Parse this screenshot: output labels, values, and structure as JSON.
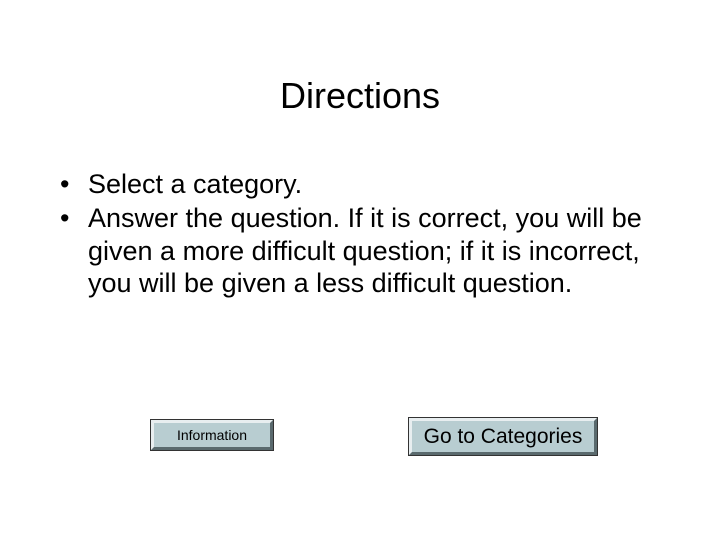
{
  "title": "Directions",
  "bullets": [
    "Select a category.",
    "Answer the question.  If it is correct, you will be given a more difficult question; if it is incorrect, you will be given a less difficult question."
  ],
  "buttons": {
    "information": "Information",
    "go_to_categories": "Go to Categories"
  }
}
